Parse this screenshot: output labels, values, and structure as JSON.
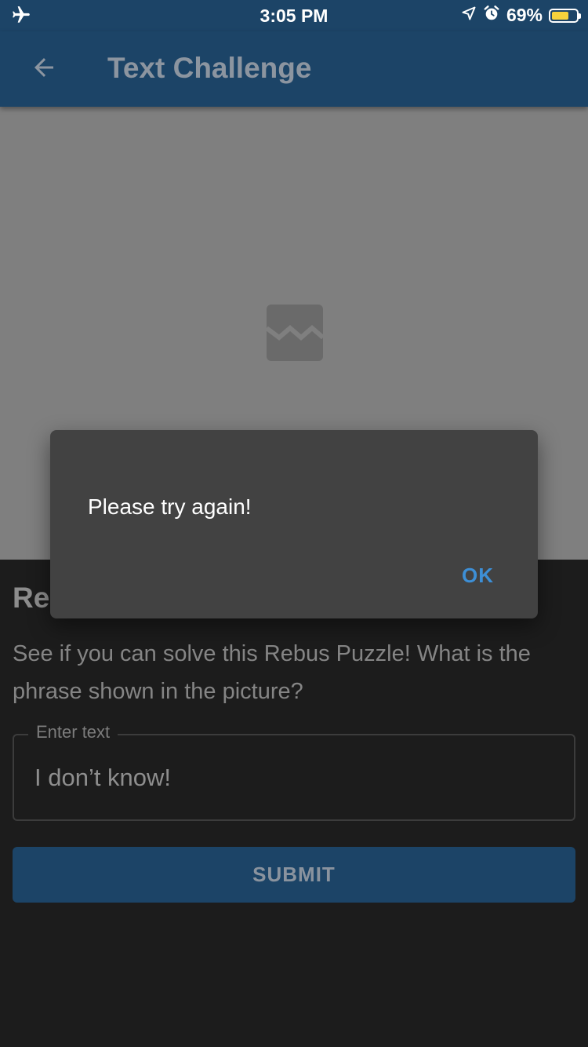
{
  "status_bar": {
    "time": "3:05 PM",
    "battery_percent": "69%",
    "battery_level": 0.69,
    "icons": [
      "airplane-icon",
      "location-arrow-icon",
      "alarm-icon",
      "battery-icon"
    ]
  },
  "app_bar": {
    "title": "Text Challenge",
    "back_icon": "arrow-left-icon"
  },
  "image_area": {
    "placeholder_icon": "broken-image-icon"
  },
  "content": {
    "title_visible": "Re",
    "description": "See if you can solve this Rebus Puzzle! What is the phrase shown in the picture?",
    "input": {
      "label": "Enter text",
      "value": "I don’t know!"
    },
    "submit_label": "SUBMIT"
  },
  "dialog": {
    "message": "Please try again!",
    "ok_label": "OK"
  },
  "colors": {
    "app_bar": "#1c4467",
    "background": "#1c1c1c",
    "dialog": "#424242",
    "accent": "#3d8fd6",
    "battery": "#f5d23c"
  }
}
